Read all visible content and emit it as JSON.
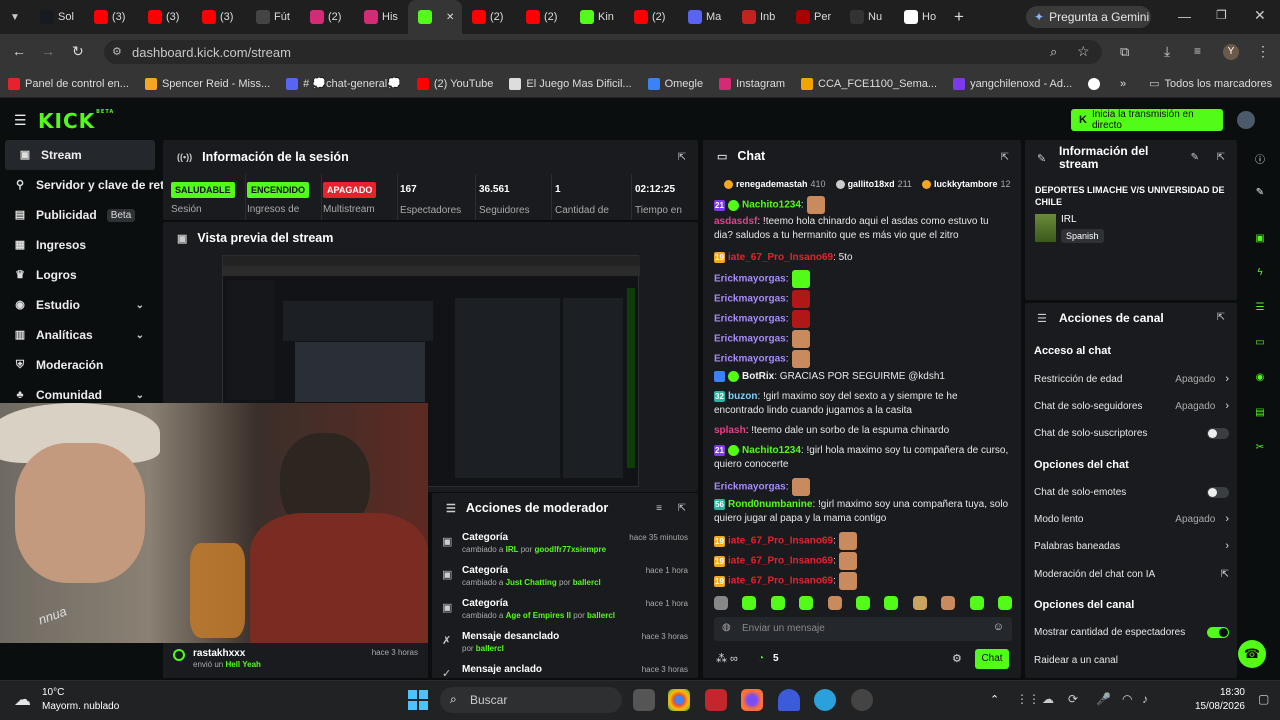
{
  "browser": {
    "tabs": [
      {
        "label": "Sol",
        "icon": "steam-icon"
      },
      {
        "label": "(3)",
        "icon": "youtube-icon"
      },
      {
        "label": "(3)",
        "icon": "youtube-icon"
      },
      {
        "label": "(3)",
        "icon": "youtube-icon"
      },
      {
        "label": "Fút",
        "icon": "dollar-icon"
      },
      {
        "label": "(2)",
        "icon": "instagram-icon"
      },
      {
        "label": "His",
        "icon": "instagram-icon"
      },
      {
        "label": "",
        "icon": "kick-icon"
      },
      {
        "label": "(2)",
        "icon": "youtube-icon"
      },
      {
        "label": "(2)",
        "icon": "youtube-icon"
      },
      {
        "label": "Kin",
        "icon": "kick-icon"
      },
      {
        "label": "(2)",
        "icon": "youtube-icon"
      },
      {
        "label": "Ma",
        "icon": "meta-icon"
      },
      {
        "label": "Inb",
        "icon": "gmail-icon"
      },
      {
        "label": "Per",
        "icon": "red-icon"
      },
      {
        "label": "Nu",
        "icon": "github-icon"
      },
      {
        "label": "Ho",
        "icon": "google-icon"
      }
    ],
    "gemini_label": "Pregunta a Gemini",
    "url": "dashboard.kick.com/stream",
    "bookmarks": [
      "Panel de control en...",
      "Spencer Reid - Miss...",
      "# 💭chat-general💭",
      "(2) YouTube",
      "El Juego Mas Dificil...",
      "Omegle",
      "Instagram",
      "CCA_FCE1100_Sema...",
      "yangchilenoxd - Ad..."
    ],
    "all_bookmarks": "Todos los marcadores",
    "profile_initial": "Y"
  },
  "header": {
    "logo": "KICK",
    "logo_sup": "BETA",
    "go_live": "Inicia la transmisión en directo"
  },
  "sidebar": {
    "items": [
      {
        "label": "Stream"
      },
      {
        "label": "Servidor y clave de retran"
      },
      {
        "label": "Publicidad",
        "badge": "Beta"
      },
      {
        "label": "Ingresos"
      },
      {
        "label": "Logros"
      },
      {
        "label": "Estudio"
      },
      {
        "label": "Analíticas"
      },
      {
        "label": "Moderación"
      },
      {
        "label": "Comunidad"
      }
    ]
  },
  "session": {
    "title": "Información de la sesión",
    "badges": [
      {
        "text": "SALUDABLE",
        "label": "Sesión",
        "color": "#53fc18"
      },
      {
        "text": "ENCENDIDO",
        "label": "Ingresos de",
        "color": "#53fc18"
      },
      {
        "text": "APAGADO",
        "label": "Multistream",
        "color": "#e8222c"
      }
    ],
    "stats": [
      {
        "value": "167",
        "label": "Espectadores"
      },
      {
        "value": "36.561",
        "label": "Seguidores"
      },
      {
        "value": "1",
        "label": "Cantidad de"
      },
      {
        "value": "02:12:25",
        "label": "Tiempo en"
      }
    ]
  },
  "preview": {
    "title": "Vista previa del stream"
  },
  "webcam": {
    "watermark": "nnua"
  },
  "sub_notice": {
    "user": "rastakhxxx",
    "text": "envió un",
    "item": "Hell Yeah",
    "time": "hace 3 horas"
  },
  "mod_actions": {
    "title": "Acciones de moderador",
    "items": [
      {
        "title": "Categoría",
        "prefix": "cambiado a",
        "value": "IRL",
        "by": "por",
        "user": "goodlfr77xsiempre",
        "time": "hace 35 minutos"
      },
      {
        "title": "Categoría",
        "prefix": "cambiado a",
        "value": "Just Chatting",
        "by": "por",
        "user": "ballercl",
        "time": "hace 1 hora"
      },
      {
        "title": "Categoría",
        "prefix": "cambiado a",
        "value": "Age of Empires II",
        "by": "por",
        "user": "ballercl",
        "time": "hace 1 hora"
      },
      {
        "title": "Mensaje desanclado",
        "prefix": "",
        "value": "",
        "by": "por",
        "user": "ballercl",
        "time": "hace 3 horas"
      },
      {
        "title": "Mensaje anclado",
        "prefix": "",
        "value": "",
        "by": "",
        "user": "",
        "time": "hace 3 horas"
      }
    ]
  },
  "chat": {
    "title": "Chat",
    "top_gifters": [
      {
        "name": "renegademastah",
        "count": "410"
      },
      {
        "name": "gallito18xd",
        "count": "211"
      },
      {
        "name": "luckkytambore",
        "count": "12"
      }
    ],
    "messages": [
      {
        "badge": "21",
        "user": "Nachito1234",
        "color": "#53fc18",
        "text": ":",
        "emote": true
      },
      {
        "badge": "",
        "user": "asdasdsf",
        "color": "#e83e8c",
        "text": ": !teemo hola chinardo aqui el asdas como estuvo tu dia? saludos a tu hermanito que es más vio que el zitro",
        "emote": false
      },
      {
        "badge": "19",
        "user": "iate_67_Pro_Insano69",
        "color": "#e8222c",
        "text": ": 5to",
        "emote": false
      },
      {
        "badge": "",
        "user": "Erickmayorgas",
        "color": "#a78bfa",
        "text": ":",
        "emote": true
      },
      {
        "badge": "",
        "user": "Erickmayorgas",
        "color": "#a78bfa",
        "text": ":",
        "emote": true
      },
      {
        "badge": "",
        "user": "Erickmayorgas",
        "color": "#a78bfa",
        "text": ":",
        "emote": true
      },
      {
        "badge": "",
        "user": "Erickmayorgas",
        "color": "#a78bfa",
        "text": ":",
        "emote": true
      },
      {
        "badge": "",
        "user": "Erickmayorgas",
        "color": "#a78bfa",
        "text": ":",
        "emote": true
      },
      {
        "badge": "bot",
        "user": "BotRix",
        "color": "#f0f0f0",
        "text": ": GRACIAS POR SEGUIRME @kdsh1",
        "emote": false
      },
      {
        "badge": "32",
        "user": "buzon",
        "color": "#7dd3fc",
        "text": ": !girl maximo soy del sexto a y siempre te he encontrado lindo cuando jugamos a la casita",
        "emote": false
      },
      {
        "badge": "",
        "user": "splash",
        "color": "#e83e8c",
        "text": ": !teemo dale un sorbo de la espuma chinardo",
        "emote": false
      },
      {
        "badge": "21",
        "user": "Nachito1234",
        "color": "#53fc18",
        "text": ": !girl hola maximo soy tu compañera de curso, quiero conocerte",
        "emote": false
      },
      {
        "badge": "",
        "user": "Erickmayorgas",
        "color": "#a78bfa",
        "text": ":",
        "emote": true
      },
      {
        "badge": "56",
        "user": "Rond0numbanine",
        "color": "#53fc18",
        "text": ": !girl maximo soy una compañera tuya, solo quiero jugar al papa y la mama contigo",
        "emote": false
      },
      {
        "badge": "19",
        "user": "iate_67_Pro_Insano69",
        "color": "#e8222c",
        "text": ":",
        "emote": true
      },
      {
        "badge": "19",
        "user": "iate_67_Pro_Insano69",
        "color": "#e8222c",
        "text": ":",
        "emote": true
      },
      {
        "badge": "19",
        "user": "iate_67_Pro_Insano69",
        "color": "#e8222c",
        "text": ":",
        "emote": true
      }
    ],
    "input_placeholder": "Enviar un mensaje",
    "points": "5",
    "send_label": "Chat"
  },
  "stream_info": {
    "title": "Información del stream",
    "stream_title": "DEPORTES LIMACHE V/S UNIVERSIDAD DE CHILE",
    "category": "IRL",
    "language": "Spanish"
  },
  "channel_actions": {
    "title": "Acciones de canal",
    "sections": [
      {
        "heading": "Acceso al chat"
      },
      {
        "heading": "Opciones del chat"
      },
      {
        "heading": "Opciones del canal"
      }
    ],
    "rows": [
      {
        "label": "Restricción de edad",
        "value": "Apagado",
        "kind": "chevron"
      },
      {
        "label": "Chat de solo-seguidores",
        "value": "Apagado",
        "kind": "chevron"
      },
      {
        "label": "Chat de solo-suscriptores",
        "value": "",
        "kind": "toggle-off"
      },
      {
        "label": "Chat de solo-emotes",
        "value": "",
        "kind": "toggle-off"
      },
      {
        "label": "Modo lento",
        "value": "Apagado",
        "kind": "chevron"
      },
      {
        "label": "Palabras baneadas",
        "value": "",
        "kind": "chevron"
      },
      {
        "label": "Moderación del chat con IA",
        "value": "",
        "kind": "external"
      },
      {
        "label": "Mostrar cantidad de espectadores",
        "value": "",
        "kind": "toggle-on"
      },
      {
        "label": "Raidear a un canal",
        "value": "",
        "kind": "none"
      }
    ]
  },
  "taskbar": {
    "temp": "10°C",
    "weather": "Mayorm. nublado",
    "search": "Buscar",
    "time": "18:30",
    "date": "15/08/2026"
  },
  "colors": {
    "accent": "#53fc18",
    "panel": "#191b1f",
    "bg": "#0b0e0f",
    "danger": "#e8222c"
  }
}
